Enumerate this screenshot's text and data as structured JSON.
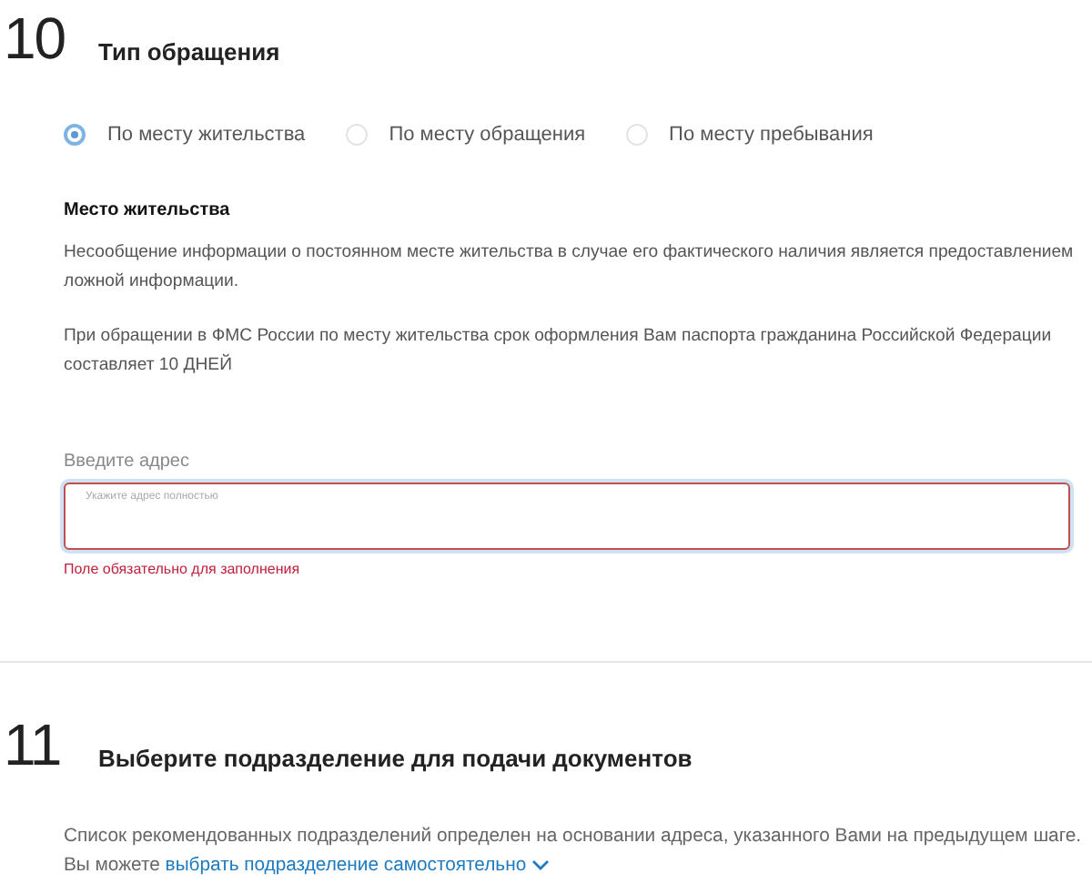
{
  "steps": [
    {
      "number": "10",
      "title": "Тип обращения",
      "radios": [
        {
          "label": "По месту жительства",
          "selected": true
        },
        {
          "label": "По месту обращения",
          "selected": false
        },
        {
          "label": "По месту пребывания",
          "selected": false
        }
      ],
      "subheading": "Место жительства",
      "paragraphs": [
        "Несообщение информации о постоянном месте жительства в случае его фактического наличия является предоставлением ложной информации.",
        "При обращении в ФМС России по месту жительства срок оформления Вам паспорта гражданина Российской Федерации составляет 10 ДНЕЙ"
      ],
      "field": {
        "label": "Введите адрес",
        "placeholder": "Укажите адрес полностью",
        "error": "Поле обязательно для заполнения"
      }
    },
    {
      "number": "11",
      "title": "Выберите подразделение для подачи документов",
      "note": {
        "text": "Список рекомендованных подразделений определен на основании адреса, указанного Вами на предыдущем шаге. Вы можете",
        "link": "выбрать подразделение самостоятельно"
      }
    }
  ]
}
